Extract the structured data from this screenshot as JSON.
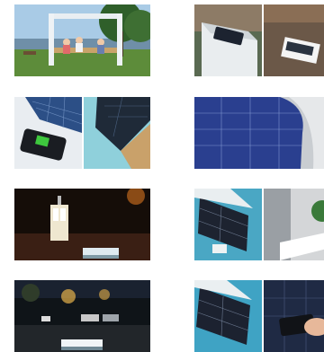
{
  "gallery": {
    "items": [
      {
        "kind": "solar-pavilion-park",
        "row": 0,
        "col": 0
      },
      {
        "kind": "bench-wood-and-dark-closeup",
        "row": 0,
        "col": 1
      },
      {
        "kind": "phone-charging-solar-panel",
        "row": 1,
        "col": 0
      },
      {
        "kind": "solar-panel-closeup-orange",
        "row": 1,
        "col": 1
      },
      {
        "kind": "night-kiosk-bench",
        "row": 2,
        "col": 0
      },
      {
        "kind": "blue-bench-panel-split",
        "row": 2,
        "col": 1
      },
      {
        "kind": "night-street-bench",
        "row": 3,
        "col": 0
      },
      {
        "kind": "charging-hand-phone-split",
        "row": 3,
        "col": 1
      }
    ]
  }
}
